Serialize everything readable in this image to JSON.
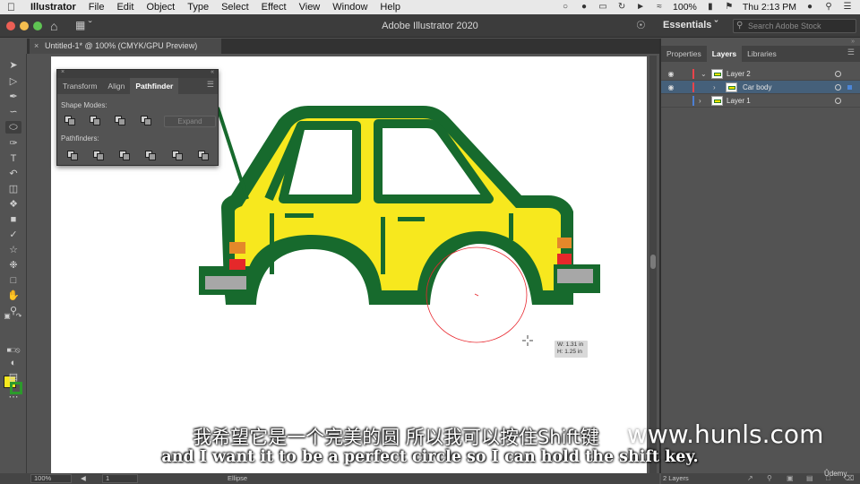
{
  "menubar": {
    "app_name": "Illustrator",
    "items": [
      "File",
      "Edit",
      "Object",
      "Type",
      "Select",
      "Effect",
      "View",
      "Window",
      "Help"
    ],
    "battery": "100%",
    "clock": "Thu 2:13 PM"
  },
  "titlebar": {
    "title": "Adobe Illustrator 2020",
    "workspace": "Essentials",
    "search_placeholder": "Search Adobe Stock"
  },
  "document_tab": {
    "label": "Untitled-1* @ 100% (CMYK/GPU Preview)"
  },
  "pathfinder_panel": {
    "tabs": [
      "Transform",
      "Align",
      "Pathfinder"
    ],
    "active_tab": "Pathfinder",
    "shape_modes_label": "Shape Modes:",
    "pathfinders_label": "Pathfinders:",
    "expand_label": "Expand"
  },
  "canvas": {
    "measure_w": "W: 1.31 in",
    "measure_h": "H: 1.25 in",
    "colors": {
      "car_yellow": "#f7e81e",
      "car_green": "#176a2d",
      "light_orange": "#e4882a",
      "light_red": "#e5282a",
      "bumper_gray": "#a7a7a7",
      "ellipse_path": "#e8262d"
    }
  },
  "layers_panel": {
    "tabs": [
      "Properties",
      "Layers",
      "Libraries"
    ],
    "active_tab": "Layers",
    "rows": [
      {
        "name": "Layer 2",
        "color": "#e8444b"
      },
      {
        "name": "Car body",
        "color": "#e8444b"
      },
      {
        "name": "Layer 1",
        "color": "#4c7fd3"
      }
    ],
    "status_count": "2 Layers"
  },
  "statusbar": {
    "zoom": "100%",
    "artboard": "1",
    "tool": "Ellipse"
  },
  "subtitles": {
    "chinese": "我希望它是一个完美的圆 所以我可以按住Shift键",
    "english": "and I want it to be a perfect circle so I can hold the shift key."
  },
  "watermark": {
    "site": "www.hunls.com",
    "brand": "Ûdemy"
  }
}
